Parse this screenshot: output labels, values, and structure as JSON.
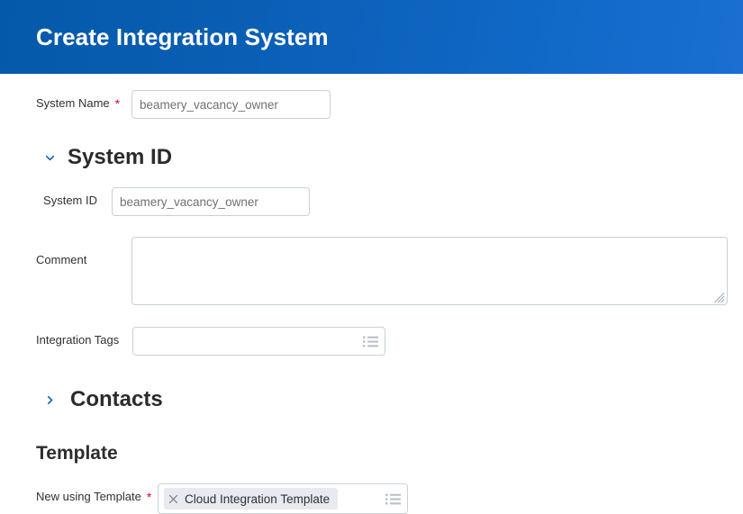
{
  "header": {
    "title": "Create Integration System",
    "gradient_start": "#0559aa",
    "gradient_end": "#1a6fd0"
  },
  "theme": {
    "accent_blue": "#1464b4",
    "required_red": "#e4002b",
    "border_gray": "#c9d0d8",
    "chip_bg": "#e7eaee",
    "value_text": "#6e7176"
  },
  "form": {
    "system_name": {
      "label": "System Name",
      "required": true,
      "required_marker": "*",
      "value": "beamery_vacancy_owner",
      "placeholder": "beamery_vacancy_owner"
    },
    "system_id_section": {
      "title": "System ID",
      "expanded": true,
      "chevron_icon": "chevron-down-icon",
      "system_id": {
        "label": "System ID",
        "required": false,
        "value": "beamery_vacancy_owner",
        "placeholder": "beamery_vacancy_owner"
      },
      "comment": {
        "label": "Comment",
        "required": false,
        "value": "",
        "placeholder": ""
      },
      "integration_tags": {
        "label": "Integration Tags",
        "required": false,
        "value": "",
        "placeholder": "",
        "icon": "list-prompt-icon"
      }
    },
    "contacts_section": {
      "title": "Contacts",
      "expanded": false,
      "chevron_icon": "chevron-right-icon"
    },
    "template_section": {
      "title": "Template",
      "new_using_template": {
        "label": "New using Template",
        "required": true,
        "required_marker": "*",
        "chip": {
          "label": "Cloud Integration Template",
          "remove_icon": "close-icon"
        },
        "icon": "list-prompt-icon"
      }
    }
  }
}
